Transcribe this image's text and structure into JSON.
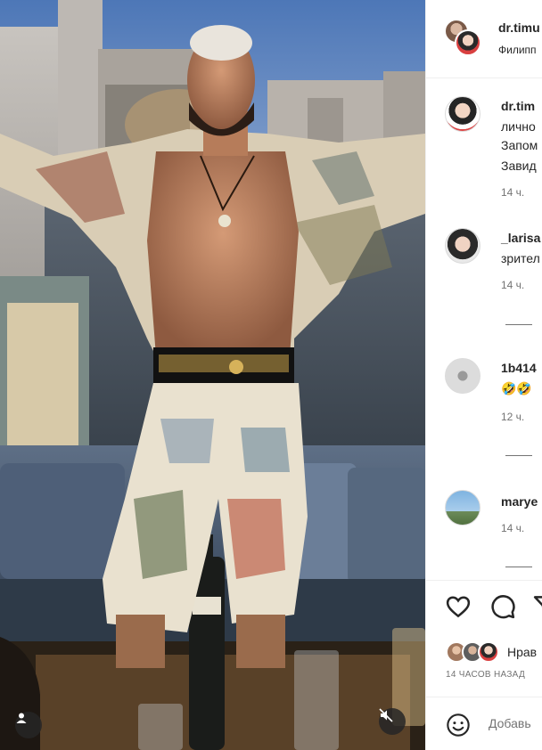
{
  "header": {
    "username": "dr.timu",
    "subtitle": "Филипп"
  },
  "comments": [
    {
      "username": "dr.tim",
      "lines": [
        "лично",
        "Запом",
        "Завид"
      ],
      "time": "14 ч."
    },
    {
      "username": "_larisa",
      "lines": [
        "зрител"
      ],
      "time": "14 ч."
    },
    {
      "username": "1b414",
      "lines": [
        "🤣🤣"
      ],
      "time": "12 ч."
    },
    {
      "username": "marye",
      "lines": [],
      "time": "14 ч."
    }
  ],
  "likes": {
    "text": "Нрав",
    "time": "14 ЧАСОВ НАЗАД"
  },
  "add_comment": {
    "placeholder": "Добавь"
  },
  "icons": {
    "like": "heart-icon",
    "comment": "comment-bubble-icon",
    "share": "send-icon",
    "tag": "user-tag-icon",
    "mute": "muted-speaker-icon",
    "emoji": "emoji-icon"
  },
  "colors": {
    "text": "#262626",
    "secondary": "#737373",
    "border": "#efefef"
  }
}
